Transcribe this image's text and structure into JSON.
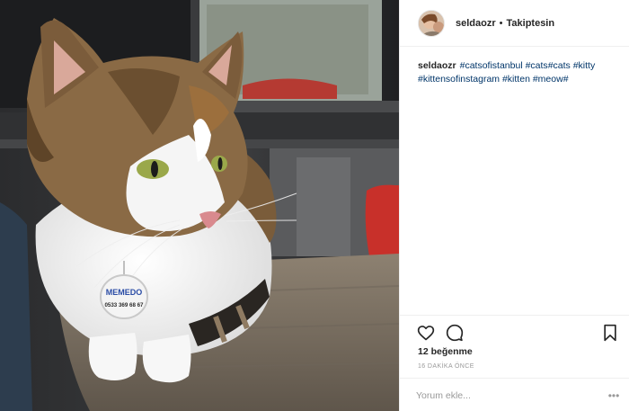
{
  "post": {
    "username": "seldaozr",
    "separator": "•",
    "follow_status": "Takiptesin",
    "caption": {
      "user": "seldaozr",
      "hashtags": [
        "#catsofistanbul",
        "#cats",
        "#cats",
        "#kitty",
        "#kittensofinstagram",
        "#kitten",
        "#meow",
        "#"
      ]
    },
    "likes": "12 beğenme",
    "time_ago": "16 DAKİKA ÖNCE",
    "comment": {
      "placeholder": "Yorum ekle...",
      "value": ""
    },
    "photo": {
      "tag_name": "MEMEDO",
      "tag_phone": "0533 369 68 67"
    }
  },
  "icons": {
    "heart": "heart-icon",
    "comment": "comment-icon",
    "bookmark": "bookmark-icon",
    "more": "more-options-icon"
  },
  "colors": {
    "hashtag": "#003569",
    "secondary_text": "#999999",
    "border": "#efefef"
  }
}
